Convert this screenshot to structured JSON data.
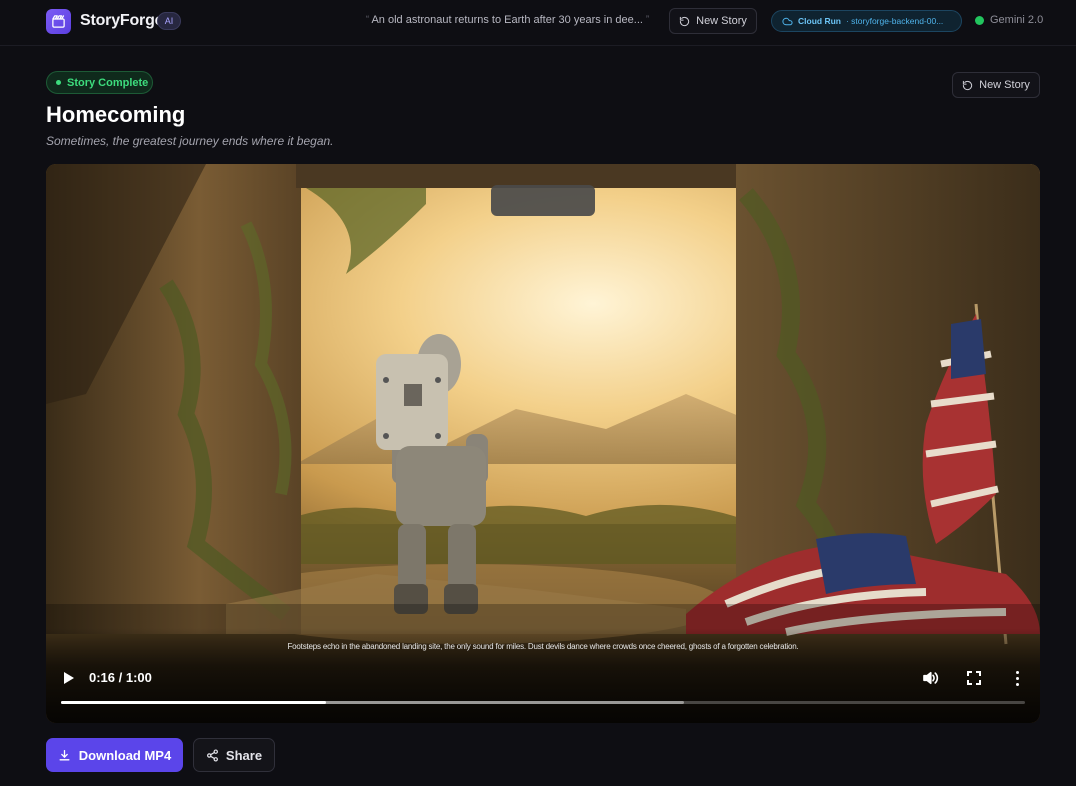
{
  "app": {
    "brand": "StoryForge",
    "badge": "AI"
  },
  "topbar": {
    "prompt_open_quote": "“",
    "prompt": "An old astronaut returns to Earth after 30 years in dee...",
    "prompt_close_quote": "”",
    "new_story_label": "New Story",
    "cloud_run_label": "Cloud Run",
    "cloud_run_service": "· storyforge-backend-00...",
    "model_label": "Gemini 2.0",
    "model_status_color": "#22c55e"
  },
  "header": {
    "status": "Story Complete",
    "title": "Homecoming",
    "tagline": "Sometimes, the greatest journey ends where it began.",
    "new_story_label": "New Story"
  },
  "player": {
    "caption": "Footsteps echo in the abandoned landing site, the only sound for miles. Dust devils dance where crowds once cheered, ghosts of a forgotten celebration.",
    "time": "0:16 / 1:00",
    "progress_fraction": 0.275,
    "buffered_fraction": 0.646
  },
  "actions": {
    "download_label": "Download MP4",
    "share_label": "Share"
  },
  "colors": {
    "accent": "#5b45ea",
    "success": "#3ddc7d",
    "cloud": "#4fb3ea"
  },
  "icons": {
    "logo": "clapperboard-icon",
    "new_story": "rotate-ccw-icon",
    "cloud": "cloud-icon",
    "download": "download-icon",
    "share": "share-icon"
  }
}
